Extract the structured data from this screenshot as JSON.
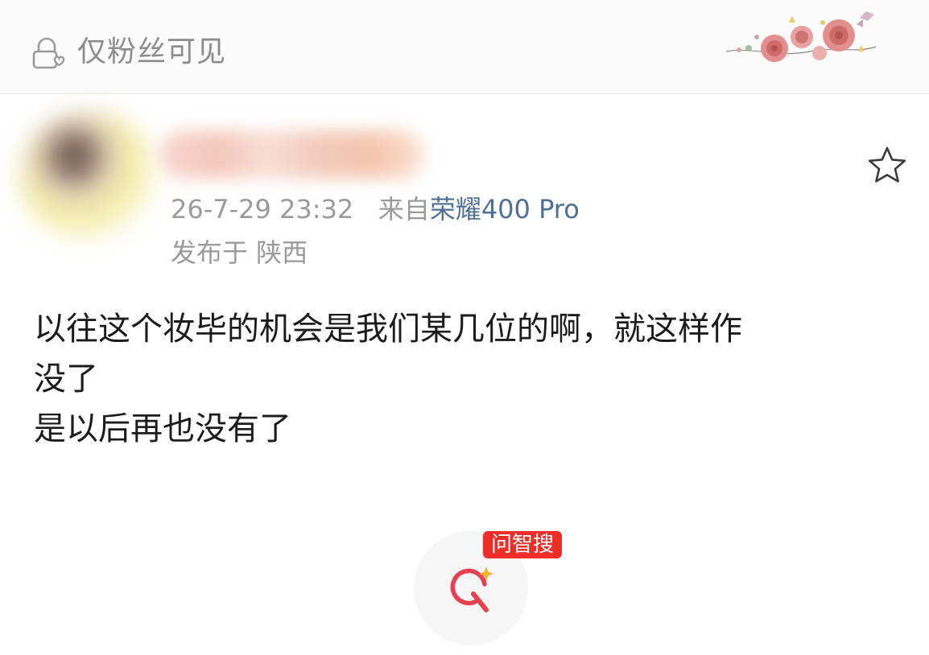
{
  "visibility": {
    "label": "仅粉丝可见",
    "icon": "lock-heart-icon"
  },
  "decoration": {
    "icon": "rose-decoration"
  },
  "author": {
    "avatar": "blurred-avatar",
    "name_blurred": true,
    "timestamp": "26-7-29 23:32",
    "source_prefix": "来自",
    "device": "荣耀400 Pro",
    "location": "发布于 陕西"
  },
  "actions": {
    "favorite_icon": "star-outline-icon"
  },
  "post": {
    "lines": [
      "以往这个妆毕的机会是我们某几位的啊，就这样作",
      "没了",
      "是以后再也没有了"
    ]
  },
  "search_fab": {
    "badge": "问智搜",
    "icon": "ai-search-icon"
  },
  "colors": {
    "accent_red": "#ec2d28",
    "device_blue": "#4e6f96",
    "meta_gray": "#9a9a9a",
    "text_dark": "#1c1c1c"
  }
}
